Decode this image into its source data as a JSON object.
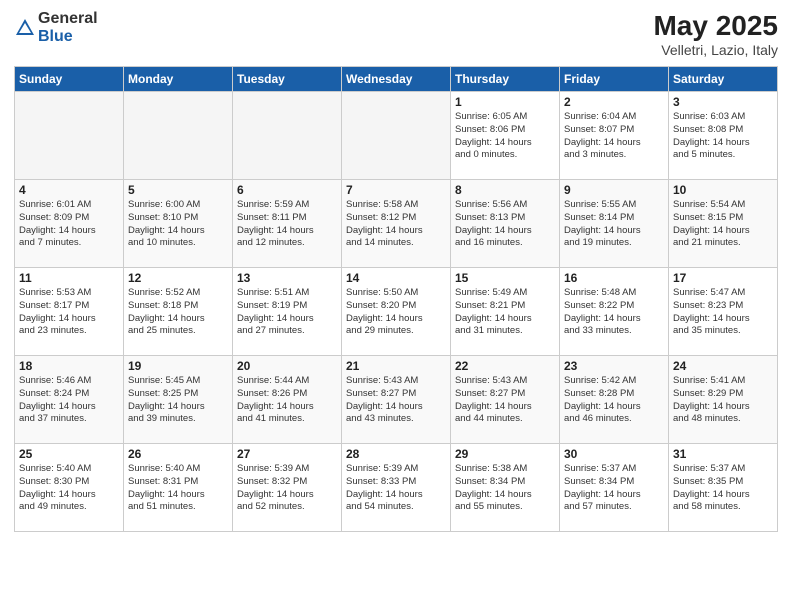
{
  "header": {
    "logo_general": "General",
    "logo_blue": "Blue",
    "month_title": "May 2025",
    "location": "Velletri, Lazio, Italy"
  },
  "weekdays": [
    "Sunday",
    "Monday",
    "Tuesday",
    "Wednesday",
    "Thursday",
    "Friday",
    "Saturday"
  ],
  "weeks": [
    [
      {
        "day": "",
        "info": ""
      },
      {
        "day": "",
        "info": ""
      },
      {
        "day": "",
        "info": ""
      },
      {
        "day": "",
        "info": ""
      },
      {
        "day": "1",
        "info": "Sunrise: 6:05 AM\nSunset: 8:06 PM\nDaylight: 14 hours\nand 0 minutes."
      },
      {
        "day": "2",
        "info": "Sunrise: 6:04 AM\nSunset: 8:07 PM\nDaylight: 14 hours\nand 3 minutes."
      },
      {
        "day": "3",
        "info": "Sunrise: 6:03 AM\nSunset: 8:08 PM\nDaylight: 14 hours\nand 5 minutes."
      }
    ],
    [
      {
        "day": "4",
        "info": "Sunrise: 6:01 AM\nSunset: 8:09 PM\nDaylight: 14 hours\nand 7 minutes."
      },
      {
        "day": "5",
        "info": "Sunrise: 6:00 AM\nSunset: 8:10 PM\nDaylight: 14 hours\nand 10 minutes."
      },
      {
        "day": "6",
        "info": "Sunrise: 5:59 AM\nSunset: 8:11 PM\nDaylight: 14 hours\nand 12 minutes."
      },
      {
        "day": "7",
        "info": "Sunrise: 5:58 AM\nSunset: 8:12 PM\nDaylight: 14 hours\nand 14 minutes."
      },
      {
        "day": "8",
        "info": "Sunrise: 5:56 AM\nSunset: 8:13 PM\nDaylight: 14 hours\nand 16 minutes."
      },
      {
        "day": "9",
        "info": "Sunrise: 5:55 AM\nSunset: 8:14 PM\nDaylight: 14 hours\nand 19 minutes."
      },
      {
        "day": "10",
        "info": "Sunrise: 5:54 AM\nSunset: 8:15 PM\nDaylight: 14 hours\nand 21 minutes."
      }
    ],
    [
      {
        "day": "11",
        "info": "Sunrise: 5:53 AM\nSunset: 8:17 PM\nDaylight: 14 hours\nand 23 minutes."
      },
      {
        "day": "12",
        "info": "Sunrise: 5:52 AM\nSunset: 8:18 PM\nDaylight: 14 hours\nand 25 minutes."
      },
      {
        "day": "13",
        "info": "Sunrise: 5:51 AM\nSunset: 8:19 PM\nDaylight: 14 hours\nand 27 minutes."
      },
      {
        "day": "14",
        "info": "Sunrise: 5:50 AM\nSunset: 8:20 PM\nDaylight: 14 hours\nand 29 minutes."
      },
      {
        "day": "15",
        "info": "Sunrise: 5:49 AM\nSunset: 8:21 PM\nDaylight: 14 hours\nand 31 minutes."
      },
      {
        "day": "16",
        "info": "Sunrise: 5:48 AM\nSunset: 8:22 PM\nDaylight: 14 hours\nand 33 minutes."
      },
      {
        "day": "17",
        "info": "Sunrise: 5:47 AM\nSunset: 8:23 PM\nDaylight: 14 hours\nand 35 minutes."
      }
    ],
    [
      {
        "day": "18",
        "info": "Sunrise: 5:46 AM\nSunset: 8:24 PM\nDaylight: 14 hours\nand 37 minutes."
      },
      {
        "day": "19",
        "info": "Sunrise: 5:45 AM\nSunset: 8:25 PM\nDaylight: 14 hours\nand 39 minutes."
      },
      {
        "day": "20",
        "info": "Sunrise: 5:44 AM\nSunset: 8:26 PM\nDaylight: 14 hours\nand 41 minutes."
      },
      {
        "day": "21",
        "info": "Sunrise: 5:43 AM\nSunset: 8:27 PM\nDaylight: 14 hours\nand 43 minutes."
      },
      {
        "day": "22",
        "info": "Sunrise: 5:43 AM\nSunset: 8:27 PM\nDaylight: 14 hours\nand 44 minutes."
      },
      {
        "day": "23",
        "info": "Sunrise: 5:42 AM\nSunset: 8:28 PM\nDaylight: 14 hours\nand 46 minutes."
      },
      {
        "day": "24",
        "info": "Sunrise: 5:41 AM\nSunset: 8:29 PM\nDaylight: 14 hours\nand 48 minutes."
      }
    ],
    [
      {
        "day": "25",
        "info": "Sunrise: 5:40 AM\nSunset: 8:30 PM\nDaylight: 14 hours\nand 49 minutes."
      },
      {
        "day": "26",
        "info": "Sunrise: 5:40 AM\nSunset: 8:31 PM\nDaylight: 14 hours\nand 51 minutes."
      },
      {
        "day": "27",
        "info": "Sunrise: 5:39 AM\nSunset: 8:32 PM\nDaylight: 14 hours\nand 52 minutes."
      },
      {
        "day": "28",
        "info": "Sunrise: 5:39 AM\nSunset: 8:33 PM\nDaylight: 14 hours\nand 54 minutes."
      },
      {
        "day": "29",
        "info": "Sunrise: 5:38 AM\nSunset: 8:34 PM\nDaylight: 14 hours\nand 55 minutes."
      },
      {
        "day": "30",
        "info": "Sunrise: 5:37 AM\nSunset: 8:34 PM\nDaylight: 14 hours\nand 57 minutes."
      },
      {
        "day": "31",
        "info": "Sunrise: 5:37 AM\nSunset: 8:35 PM\nDaylight: 14 hours\nand 58 minutes."
      }
    ]
  ]
}
